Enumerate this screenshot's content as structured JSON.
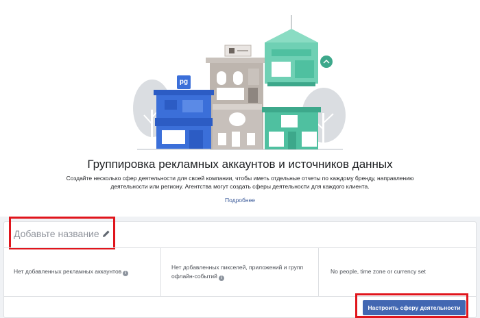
{
  "hero": {
    "title": "Группировка рекламных аккаунтов и источников данных",
    "description": "Создайте несколько сфер деятельности для своей компании, чтобы иметь отдельные отчеты по каждому бренду, направлению деятельности или региону. Агентства могут создать сферы деятельности для каждого клиента.",
    "learn_more": "Подробнее",
    "storefront_logo": "pg"
  },
  "card": {
    "name_placeholder": "Добавьте название",
    "stats": [
      {
        "text": "Нет добавленных рекламных аккаунтов"
      },
      {
        "text": "Нет добавленных пикселей, приложений и групп офлайн-событий"
      },
      {
        "text": "No people, time zone or currency set"
      }
    ],
    "setup_button": "Настроить сферу деятельности"
  },
  "colors": {
    "accent": "#4267b2",
    "highlight": "#e0151c",
    "blue_shop": "#3b6fd9",
    "green_shop": "#4fc0a0",
    "gray_shop": "#c7c0bb"
  },
  "icons": [
    "pencil-icon",
    "info-icon",
    "storefront-illustration"
  ]
}
